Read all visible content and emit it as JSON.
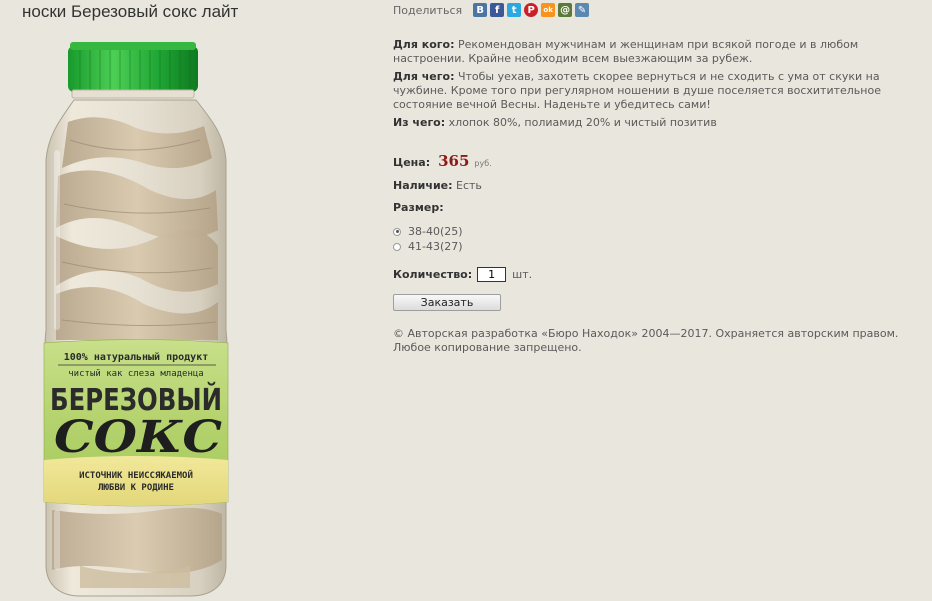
{
  "product": {
    "title": "носки Березовый сокс лайт",
    "image": {
      "label_top": "100% натуральный продукт",
      "label_sub": "чистый как слеза младенца",
      "brand_line1": "БЕРЕЗОВЫЙ",
      "brand_line2": "СОКС",
      "slogan_line1": "ИСТОЧНИК НЕИССЯКАЕМОЙ",
      "slogan_line2": "ЛЮБВИ К РОДИНЕ"
    }
  },
  "share": {
    "label": "Поделиться",
    "icons": [
      {
        "name": "vkontakte-icon",
        "glyph": "В",
        "color": "#4c75a3"
      },
      {
        "name": "facebook-icon",
        "glyph": "f",
        "color": "#3b5998"
      },
      {
        "name": "twitter-icon",
        "glyph": "t",
        "color": "#2aa9e0"
      },
      {
        "name": "pinterest-icon",
        "glyph": "P",
        "color": "#cb2027"
      },
      {
        "name": "odnoklassniki-icon",
        "glyph": "ok",
        "color": "#f7931e"
      },
      {
        "name": "moimir-icon",
        "glyph": "@",
        "color": "#5a7a3a"
      },
      {
        "name": "livejournal-icon",
        "glyph": "✎",
        "color": "#5a88b0"
      }
    ]
  },
  "info": {
    "for_whom_label": "Для кого:",
    "for_whom_text": "Рекомендован мужчинам и женщинам при всякой погоде и в любом настроении. Крайне необходим всем выезжающим за рубеж.",
    "purpose_label": "Для чего:",
    "purpose_text": "Чтобы уехав, захотеть скорее вернуться и не сходить с ума от скуки на чужбине. Кроме того при регулярном ношении в душе поселяется восхитительное состояние вечной Весны. Наденьте и убедитесь сами!",
    "material_label": "Из чего:",
    "material_text": "хлопок 80%, полиамид 20% и чистый позитив"
  },
  "price": {
    "label": "Цена:",
    "value": "365",
    "currency": "руб."
  },
  "availability": {
    "label": "Наличие:",
    "value": "Есть"
  },
  "size": {
    "label": "Размер:",
    "options": [
      {
        "label": "38-40(25)",
        "selected": true
      },
      {
        "label": "41-43(27)",
        "selected": false
      }
    ]
  },
  "quantity": {
    "label": "Количество:",
    "value": "1",
    "unit": "шт."
  },
  "order_button": "Заказать",
  "copyright": "© Авторская разработка «Бюро Находок» 2004—2017. Охраняется авторским правом. Любое копирование запрещено."
}
